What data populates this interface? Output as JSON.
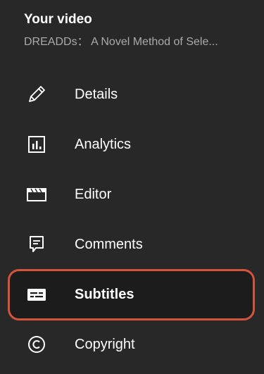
{
  "header": {
    "title": "Your video",
    "subtitle": "DREADDs： A Novel Method of Sele..."
  },
  "menu": {
    "items": [
      {
        "label": "Details",
        "icon": "pencil-icon"
      },
      {
        "label": "Analytics",
        "icon": "bar-chart-icon"
      },
      {
        "label": "Editor",
        "icon": "clapperboard-icon"
      },
      {
        "label": "Comments",
        "icon": "comment-icon"
      },
      {
        "label": "Subtitles",
        "icon": "subtitles-icon",
        "selected": true
      },
      {
        "label": "Copyright",
        "icon": "copyright-icon"
      }
    ]
  },
  "colors": {
    "background": "#282828",
    "selected_background": "#1c1c1c",
    "highlight_border": "#d4533d",
    "subtitle_text": "#aaaaaa"
  }
}
